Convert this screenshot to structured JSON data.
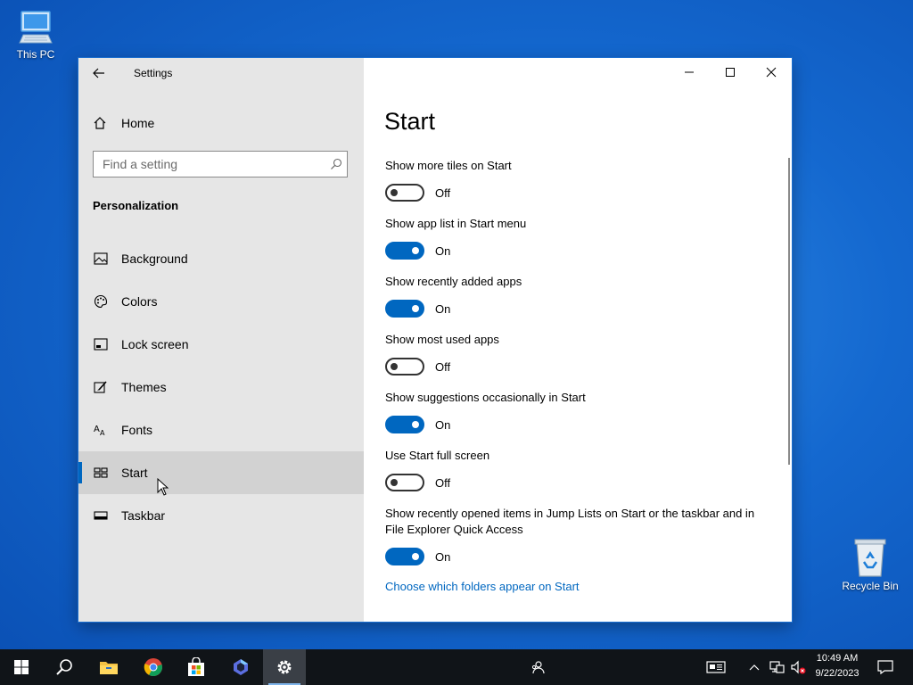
{
  "desktop": {
    "icons": [
      {
        "label": "This PC",
        "icon": "computer-icon"
      },
      {
        "label": "Recycle Bin",
        "icon": "recycle-bin-icon"
      }
    ]
  },
  "window": {
    "title": "Settings",
    "controls": [
      "minimize-icon",
      "maximize-icon",
      "close-icon"
    ]
  },
  "sidebar": {
    "home_label": "Home",
    "search_placeholder": "Find a setting",
    "section_title": "Personalization",
    "items": [
      {
        "label": "Background",
        "icon": "picture-icon",
        "selected": false
      },
      {
        "label": "Colors",
        "icon": "palette-icon",
        "selected": false
      },
      {
        "label": "Lock screen",
        "icon": "lock-screen-icon",
        "selected": false
      },
      {
        "label": "Themes",
        "icon": "brush-icon",
        "selected": false
      },
      {
        "label": "Fonts",
        "icon": "fonts-icon",
        "selected": false
      },
      {
        "label": "Start",
        "icon": "start-icon",
        "selected": true
      },
      {
        "label": "Taskbar",
        "icon": "taskbar-icon",
        "selected": false
      }
    ]
  },
  "main": {
    "title": "Start",
    "settings": [
      {
        "label": "Show more tiles on Start",
        "state": "Off"
      },
      {
        "label": "Show app list in Start menu",
        "state": "On"
      },
      {
        "label": "Show recently added apps",
        "state": "On"
      },
      {
        "label": "Show most used apps",
        "state": "Off"
      },
      {
        "label": "Show suggestions occasionally in Start",
        "state": "On"
      },
      {
        "label": "Use Start full screen",
        "state": "Off"
      },
      {
        "label": "Show recently opened items in Jump Lists on Start or the taskbar and in File Explorer Quick Access",
        "state": "On"
      }
    ],
    "link": "Choose which folders appear on Start"
  },
  "taskbar": {
    "apps": [
      "windows-start-icon",
      "search-icon",
      "file-explorer-icon",
      "chrome-icon",
      "microsoft-store-icon",
      "copilot-icon",
      "settings-gear-icon"
    ],
    "tray": [
      "people-icon",
      "news-icon",
      "chevron-up-icon",
      "network-icon",
      "volume-muted-icon",
      "notifications-icon"
    ],
    "time": "10:49 AM",
    "date": "9/22/2023"
  }
}
